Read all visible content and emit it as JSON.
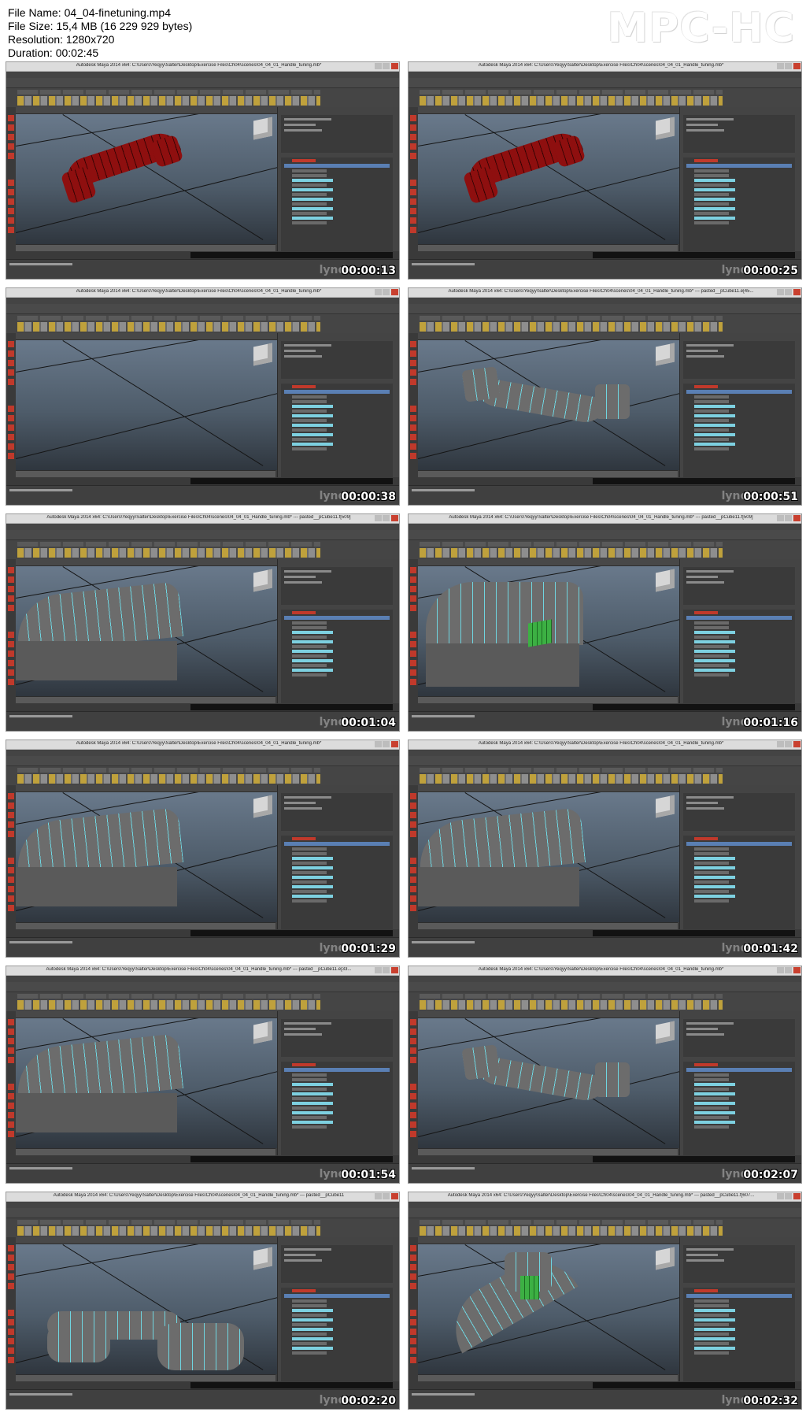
{
  "header": {
    "file_name": "File Name: 04_04-finetuning.mp4",
    "file_size": "File Size: 15,4 MB (16 229 929 bytes)",
    "resolution": "Resolution: 1280x720",
    "duration": "Duration: 00:02:45",
    "logo": "MPC-HC"
  },
  "thumbnails": [
    {
      "timestamp": "00:00:13",
      "model": "red",
      "title": "Autodesk Maya 2014 x64: C:\\Users\\Yeqyy\\Salter\\Desktop\\Exercise Files\\Ch04\\scenes\\04_04_01_Handle_tuning.mb*"
    },
    {
      "timestamp": "00:00:25",
      "model": "red",
      "title": "Autodesk Maya 2014 x64: C:\\Users\\Yeqyy\\Salter\\Desktop\\Exercise Files\\Ch04\\scenes\\04_04_01_Handle_tuning.mb*"
    },
    {
      "timestamp": "00:00:38",
      "model": "none",
      "title": "Autodesk Maya 2014 x64: C:\\Users\\Yeqyy\\Salter\\Desktop\\Exercise Files\\Ch04\\scenes\\04_04_01_Handle_tuning.mb*"
    },
    {
      "timestamp": "00:00:51",
      "model": "gray",
      "title": "Autodesk Maya 2014 x64: C:\\Users\\Yeqyy\\Salter\\Desktop\\Exercise Files\\Ch04\\scenes\\04_04_01_Handle_tuning.mb* --- pasted__pCube11.e[45..."
    },
    {
      "timestamp": "00:01:04",
      "model": "gray-close",
      "title": "Autodesk Maya 2014 x64: C:\\Users\\Yeqyy\\Salter\\Desktop\\Exercise Files\\Ch04\\scenes\\04_04_01_Handle_tuning.mb* --- pasted__pCube11.f[509]"
    },
    {
      "timestamp": "00:01:16",
      "model": "gray-sel",
      "title": "Autodesk Maya 2014 x64: C:\\Users\\Yeqyy\\Salter\\Desktop\\Exercise Files\\Ch04\\scenes\\04_04_01_Handle_tuning.mb* --- pasted__pCube11.f[509]"
    },
    {
      "timestamp": "00:01:29",
      "model": "gray-close",
      "title": "Autodesk Maya 2014 x64: C:\\Users\\Yeqyy\\Salter\\Desktop\\Exercise Files\\Ch04\\scenes\\04_04_01_Handle_tuning.mb*"
    },
    {
      "timestamp": "00:01:42",
      "model": "gray-close",
      "title": "Autodesk Maya 2014 x64: C:\\Users\\Yeqyy\\Salter\\Desktop\\Exercise Files\\Ch04\\scenes\\04_04_01_Handle_tuning.mb*"
    },
    {
      "timestamp": "00:01:54",
      "model": "gray-close",
      "title": "Autodesk Maya 2014 x64: C:\\Users\\Yeqyy\\Salter\\Desktop\\Exercise Files\\Ch04\\scenes\\04_04_01_Handle_tuning.mb* --- pasted__pCube11.e[33..."
    },
    {
      "timestamp": "00:02:07",
      "model": "gray",
      "title": "Autodesk Maya 2014 x64: C:\\Users\\Yeqyy\\Salter\\Desktop\\Exercise Files\\Ch04\\scenes\\04_04_01_Handle_tuning.mb*"
    },
    {
      "timestamp": "00:02:20",
      "model": "gray-smooth",
      "title": "Autodesk Maya 2014 x64: C:\\Users\\Yeqyy\\Salter\\Desktop\\Exercise Files\\Ch04\\scenes\\04_04_01_Handle_tuning.mb* --- pasted__pCube11"
    },
    {
      "timestamp": "00:02:32",
      "model": "gray-sel2",
      "title": "Autodesk Maya 2014 x64: C:\\Users\\Yeqyy\\Salter\\Desktop\\Exercise Files\\Ch04\\scenes\\04_04_01_Handle_tuning.mb* --- pasted__pCube11.f[607..."
    }
  ],
  "watermark": "lynda"
}
